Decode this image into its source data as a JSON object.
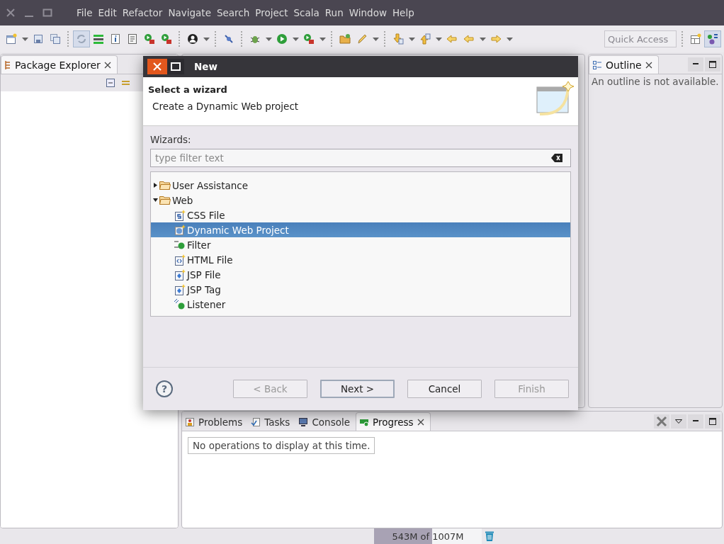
{
  "menu": [
    "File",
    "Edit",
    "Refactor",
    "Navigate",
    "Search",
    "Project",
    "Scala",
    "Run",
    "Window",
    "Help"
  ],
  "toolbar": {
    "quick_access": {
      "placeholder": "Quick Access"
    }
  },
  "package_explorer": {
    "tab": {
      "label": "Package Explorer",
      "selected": true
    }
  },
  "outline": {
    "tab": {
      "label": "Outline",
      "selected": true
    },
    "message": "An outline is not available."
  },
  "bottom_panel": {
    "tabs": [
      {
        "label": "Problems",
        "selected": false
      },
      {
        "label": "Tasks",
        "selected": false
      },
      {
        "label": "Console",
        "selected": false
      },
      {
        "label": "Progress",
        "selected": true
      }
    ],
    "message": "No operations to display at this time."
  },
  "status_bar": {
    "heap": {
      "text": "543M of 1007M",
      "level": 0.54
    }
  },
  "dialog": {
    "title": "New",
    "header": {
      "title": "Select a wizard",
      "description": "Create a Dynamic Web project"
    },
    "filter": {
      "label": "Wizards:",
      "placeholder": "type filter text"
    },
    "tree": [
      {
        "label": "User Assistance",
        "kind": "category",
        "expanded": false,
        "selected": false
      },
      {
        "label": "Web",
        "kind": "category",
        "expanded": true,
        "selected": false,
        "children": [
          {
            "label": "CSS File",
            "kind": "wizard",
            "selected": false
          },
          {
            "label": "Dynamic Web Project",
            "kind": "wizard",
            "selected": true
          },
          {
            "label": "Filter",
            "kind": "wizard",
            "selected": false
          },
          {
            "label": "HTML File",
            "kind": "wizard",
            "selected": false
          },
          {
            "label": "JSP File",
            "kind": "wizard",
            "selected": false
          },
          {
            "label": "JSP Tag",
            "kind": "wizard",
            "selected": false
          },
          {
            "label": "Listener",
            "kind": "wizard",
            "selected": false
          }
        ]
      }
    ],
    "help": "?",
    "buttons": [
      {
        "label": "< Back",
        "disabled": true,
        "default": false
      },
      {
        "label": "Next >",
        "disabled": false,
        "default": true
      },
      {
        "label": "Cancel",
        "disabled": false,
        "default": false
      },
      {
        "label": "Finish",
        "disabled": true,
        "default": false
      }
    ]
  }
}
